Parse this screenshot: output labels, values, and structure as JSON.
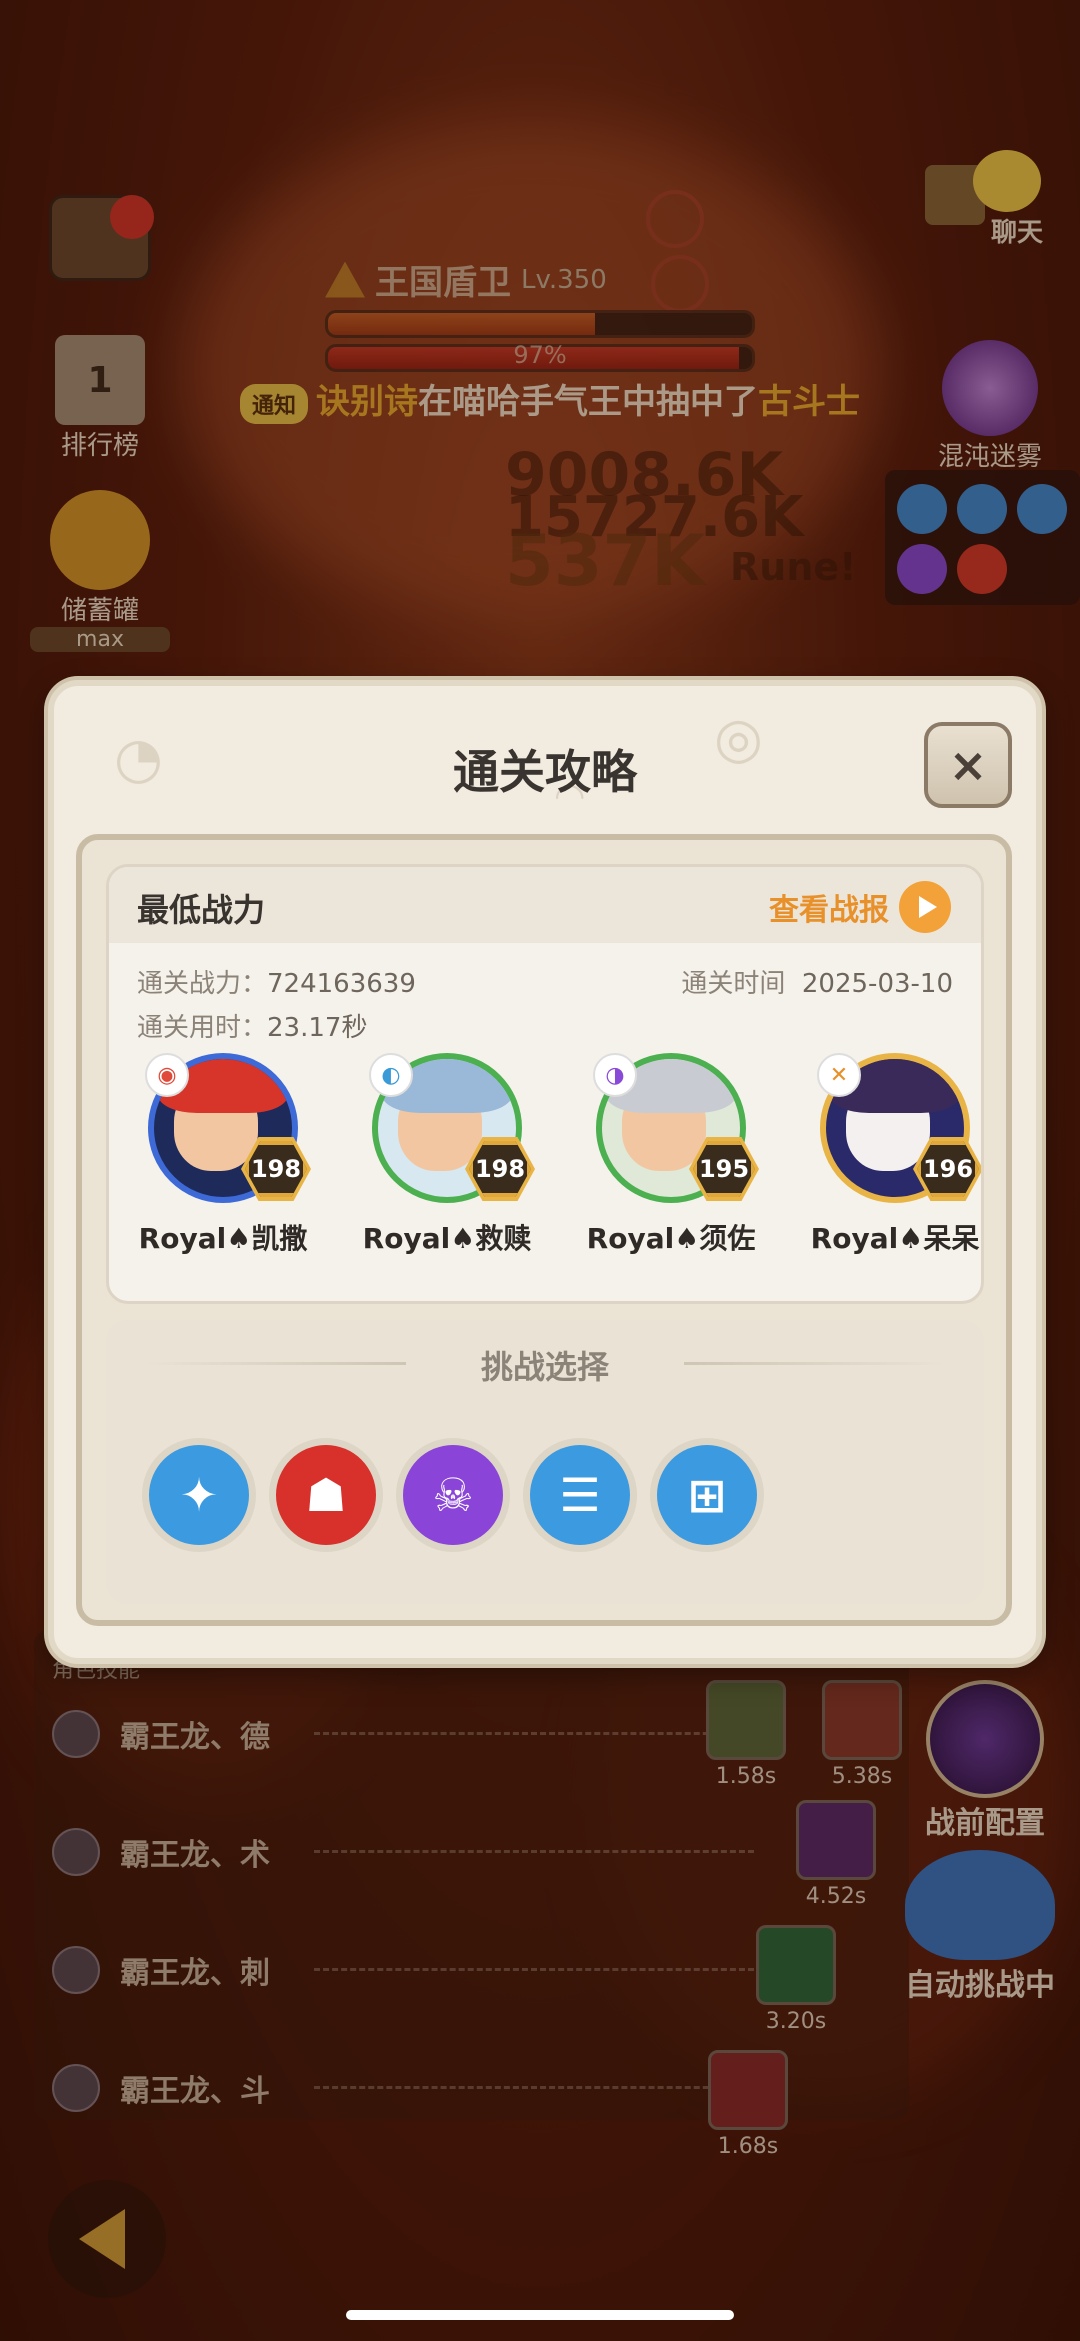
{
  "hud": {
    "chat_label": "聊天",
    "rank_label": "排行榜",
    "rank_value": "1",
    "piggy_label": "储蓄罐",
    "piggy_value": "max",
    "chaos_label": "混沌迷雾"
  },
  "boss": {
    "name": "王国盾卫",
    "level": "Lv.350",
    "hp_percent": "97%",
    "hp_fraction": 0.63,
    "shield_fraction": 0.97
  },
  "notice": {
    "tag": "通知",
    "player": "诀别诗",
    "text": "在喵哈手气王中抽中了",
    "item": "古斗士"
  },
  "damage": {
    "line1": "9008.6K",
    "line2": "15727.6K",
    "line3": "537K",
    "rune": "Rune!"
  },
  "modal": {
    "title": "通关攻略",
    "close": "×",
    "card_title": "最低战力",
    "report_label": "查看战报",
    "power_label": "通关战力：",
    "power_value": "724163639",
    "date_label": "通关时间",
    "date_value": "2025-03-10",
    "time_label": "通关用时：",
    "time_value": "23.17秒",
    "heroes": [
      {
        "name": "Royal♠凯撒",
        "level": "198",
        "element": "fire"
      },
      {
        "name": "Royal♠救赎",
        "level": "198",
        "element": "wind"
      },
      {
        "name": "Royal♠须佐",
        "level": "195",
        "element": "dark"
      },
      {
        "name": "Royal♠呆呆",
        "level": "196",
        "element": "sword"
      }
    ],
    "challenge_title": "挑战选择",
    "challenges": [
      "star-badge-icon",
      "red-demon-icon",
      "purple-skull-icon",
      "blue-scroll-icon",
      "blue-rune-icon"
    ]
  },
  "skills": {
    "header": "角色技能",
    "rows": [
      "霸王龙、德",
      "霸王龙、术",
      "霸王龙、刺",
      "霸王龙、斗"
    ],
    "cooldowns": [
      "1.58s",
      "5.38s",
      "4.52s",
      "3.20s",
      "1.68s"
    ]
  },
  "side": {
    "prebattle": "战前配置",
    "auto": "自动挑战中"
  },
  "colors": {
    "accent": "#e8902a",
    "blue_ring": "#3e6ad8",
    "green_ring": "#4caf50",
    "level_badge": "#e8b446"
  }
}
